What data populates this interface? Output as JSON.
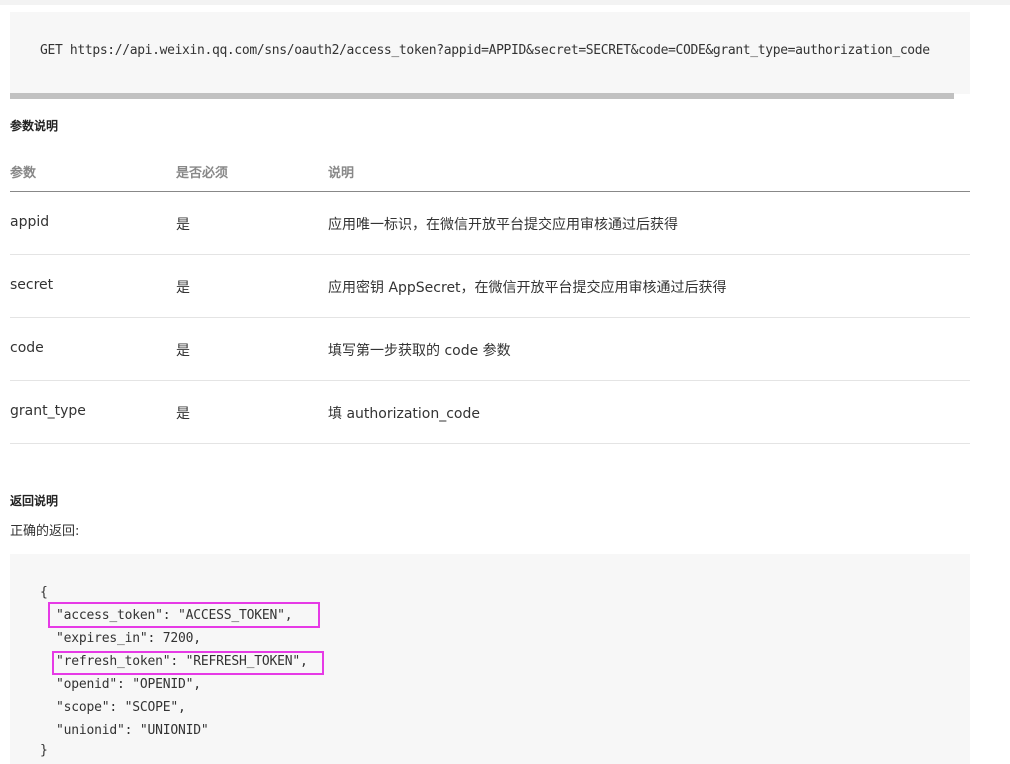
{
  "request": {
    "line": "GET https://api.weixin.qq.com/sns/oauth2/access_token?appid=APPID&secret=SECRET&code=CODE&grant_type=authorization_code"
  },
  "params": {
    "heading": "参数说明",
    "columns": [
      "参数",
      "是否必须",
      "说明"
    ],
    "rows": [
      {
        "name": "appid",
        "required": "是",
        "desc": "应用唯一标识，在微信开放平台提交应用审核通过后获得"
      },
      {
        "name": "secret",
        "required": "是",
        "desc": "应用密钥 AppSecret，在微信开放平台提交应用审核通过后获得"
      },
      {
        "name": "code",
        "required": "是",
        "desc": "填写第一步获取的 code 参数"
      },
      {
        "name": "grant_type",
        "required": "是",
        "desc": "填 authorization_code"
      }
    ]
  },
  "response": {
    "heading": "返回说明",
    "subheading": "正确的返回:",
    "lines": [
      "{",
      "\"access_token\": \"ACCESS_TOKEN\",",
      "\"expires_in\": 7200,",
      "\"refresh_token\": \"REFRESH_TOKEN\",",
      "\"openid\": \"OPENID\",",
      "\"scope\": \"SCOPE\",",
      "\"unionid\": \"UNIONID\"",
      "}"
    ]
  },
  "colors": {
    "highlight": "#e63ae6",
    "code_background": "#f7f7f7"
  }
}
